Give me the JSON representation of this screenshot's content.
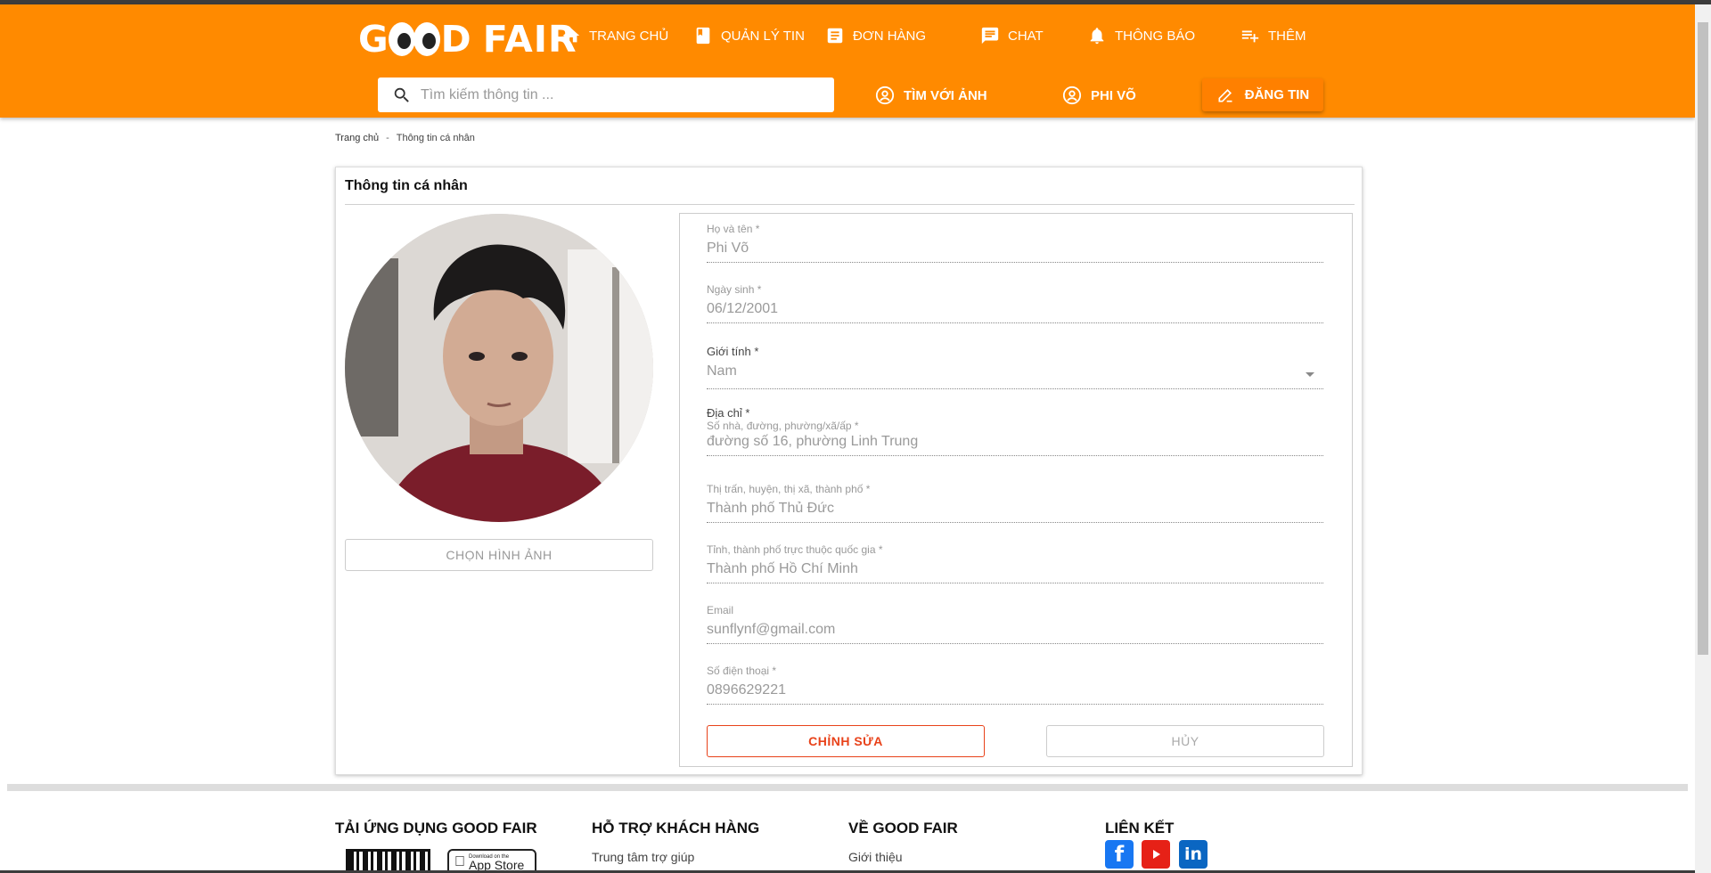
{
  "header": {
    "logo_part1": "G",
    "logo_part2": "D",
    "logo_part3": "FAIR",
    "nav": {
      "home": "TRANG CHỦ",
      "news": "QUẢN LÝ TIN",
      "orders": "ĐƠN HÀNG",
      "chat": "CHAT",
      "notifications": "THÔNG BÁO",
      "more": "THÊM"
    },
    "search_placeholder": "Tìm kiếm thông tin ...",
    "search_by_image": "TÌM VỚI ẢNH",
    "user_name": "PHI VÕ",
    "post": "ĐĂNG TIN"
  },
  "breadcrumb": {
    "home": "Trang chủ",
    "separator": "-",
    "current": "Thông tin cá nhân"
  },
  "profile": {
    "title": "Thông tin cá nhân",
    "choose_image": "CHỌN HÌNH ẢNH",
    "fields": {
      "fullname_label": "Họ và tên *",
      "fullname_value": "Phi Võ",
      "dob_label": "Ngày sinh *",
      "dob_value": "06/12/2001",
      "gender_label": "Giới tính *",
      "gender_value": "Nam",
      "address_label": "Địa chỉ *",
      "street_label": "Số nhà, đường, phường/xã/ấp *",
      "street_value": "đường số 16, phường Linh Trung",
      "district_label": "Thị trấn, huyện, thị xã, thành phố *",
      "district_value": "Thành phố Thủ Đức",
      "province_label": "Tỉnh, thành phố trực thuộc quốc gia *",
      "province_value": "Thành phố Hồ Chí Minh",
      "email_label": "Email",
      "email_value": "sunflynf@gmail.com",
      "phone_label": "Số điện thoại *",
      "phone_value": "0896629221"
    },
    "edit": "CHỈNH SỬA",
    "cancel": "HỦY"
  },
  "footer": {
    "app_title": "TẢI ỨNG DỤNG GOOD FAIR",
    "support_title": "HỖ TRỢ KHÁCH HÀNG",
    "support_link": "Trung tâm trợ giúp",
    "about_title": "VỀ GOOD FAIR",
    "about_link": "Giới thiệu",
    "links_title": "LIÊN KẾT",
    "appstore_small": "Download on the",
    "appstore_big": "App Store"
  },
  "colors": {
    "header_bg": "#ff8a00",
    "edit_accent": "#e8421a",
    "facebook": "#1877f2",
    "youtube": "#e62117",
    "linkedin": "#0a66c2"
  },
  "icons": [
    "home-icon",
    "book-icon",
    "list-icon",
    "chat-icon",
    "bell-icon",
    "playlist-add-icon",
    "search-icon",
    "user-circle-icon",
    "pencil-icon",
    "apple-icon",
    "facebook-icon",
    "youtube-icon",
    "linkedin-icon"
  ]
}
